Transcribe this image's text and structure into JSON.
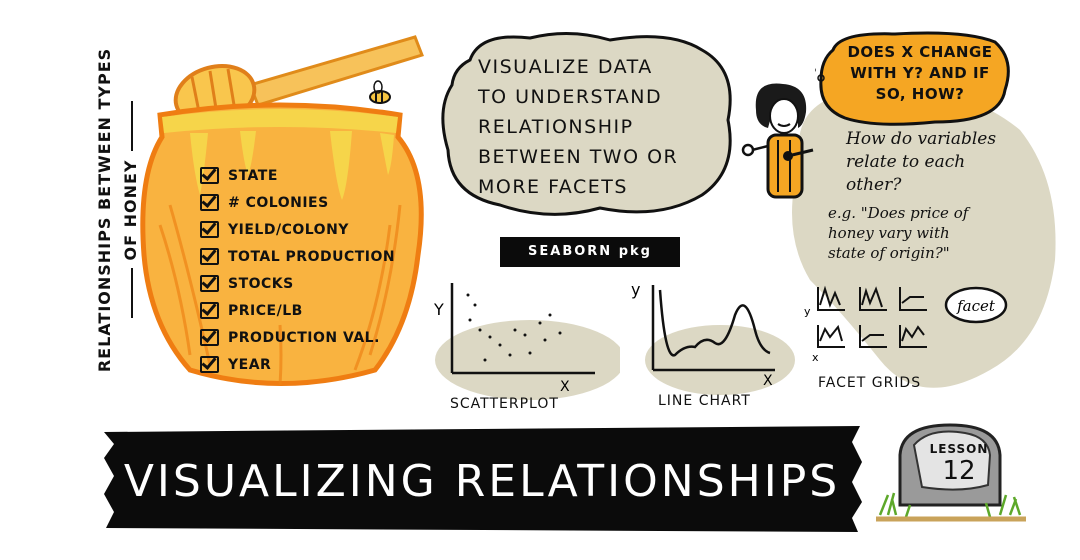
{
  "side_title": {
    "line1": "RELATIONSHIPS BETWEEN TYPES",
    "line2": "OF HONEY"
  },
  "jar": {
    "items": [
      "STATE",
      "# COLONIES",
      "YIELD/COLONY",
      "TOTAL PRODUCTION",
      "STOCKS",
      "PRICE/LB",
      "PRODUCTION VAL.",
      "YEAR"
    ]
  },
  "cloud": {
    "lines": [
      "VISUALIZE DATA",
      "TO UNDERSTAND",
      "RELATIONSHIP",
      "BETWEEN TWO OR",
      "MORE FACETS"
    ]
  },
  "seaborn": {
    "label": "SEABORN pkg"
  },
  "question": {
    "lines": [
      "DOES X CHANGE",
      "WITH Y? AND IF",
      "SO, HOW?"
    ]
  },
  "notes": {
    "note1": [
      "How do variables",
      "relate to each",
      "other?"
    ],
    "note2": [
      "e.g. \"Does price of",
      "honey vary with",
      "state of origin?\""
    ]
  },
  "charts": {
    "scatter": {
      "label": "SCATTERPLOT",
      "xaxis": "X",
      "yaxis": "Y"
    },
    "line": {
      "label": "LINE CHART",
      "xaxis": "X",
      "yaxis": "y"
    },
    "facet": {
      "label": "FACET GRIDS",
      "badge": "facet",
      "xaxis": "x",
      "yaxis": "y"
    }
  },
  "banner": {
    "title": "VISUALIZING RELATIONSHIPS"
  },
  "lesson": {
    "word": "LESSON",
    "number": "12"
  },
  "colors": {
    "honey": "#f5a623",
    "honey_light": "#f9d04a",
    "blob": "#dcd8c4",
    "banner": "#0b0b0b",
    "hair": "#1a1a1a",
    "stone": "#9a9a9a"
  }
}
